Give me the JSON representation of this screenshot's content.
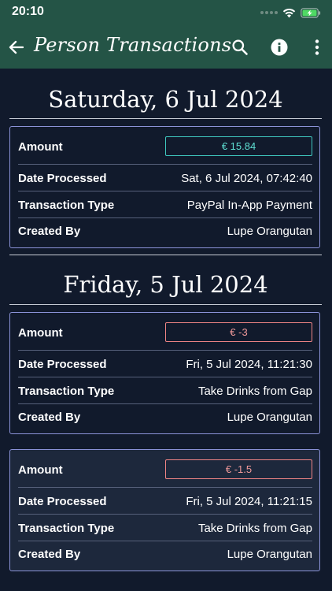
{
  "status_bar": {
    "time": "20:10"
  },
  "app_bar": {
    "title": "Person Transactions"
  },
  "colors": {
    "bar_bg": "#245446",
    "page_bg": "#111a2c",
    "card_border": "#8b93d8",
    "positive": "#5fe0d4",
    "negative": "#f29a9a"
  },
  "labels": {
    "amount": "Amount",
    "date_processed": "Date Processed",
    "transaction_type": "Transaction Type",
    "created_by": "Created By"
  },
  "groups": [
    {
      "heading": "Saturday, 6 Jul 2024",
      "transactions": [
        {
          "amount": "€ 15.84",
          "sign": "positive",
          "date_processed": "Sat, 6 Jul 2024, 07:42:40",
          "transaction_type": "PayPal In-App Payment",
          "created_by": "Lupe Orangutan"
        }
      ]
    },
    {
      "heading": "Friday, 5 Jul 2024",
      "transactions": [
        {
          "amount": "€ -3",
          "sign": "negative",
          "date_processed": "Fri, 5 Jul 2024, 11:21:30",
          "transaction_type": "Take Drinks from Gap",
          "created_by": "Lupe Orangutan"
        },
        {
          "amount": "€ -1.5",
          "sign": "negative",
          "date_processed": "Fri, 5 Jul 2024, 11:21:15",
          "transaction_type": "Take Drinks from Gap",
          "created_by": "Lupe Orangutan"
        }
      ]
    }
  ]
}
